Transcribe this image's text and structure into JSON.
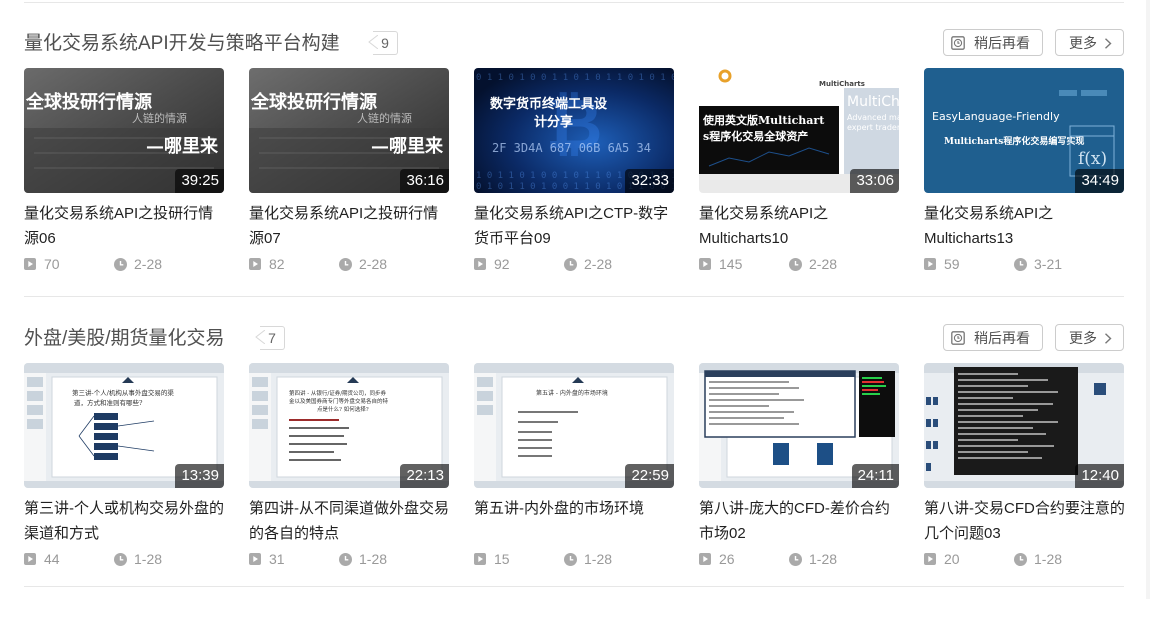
{
  "sections": [
    {
      "title": "量化交易系统API开发与策略平台构建",
      "count": "9",
      "watch_later_label": "稍后再看",
      "more_label": "更多",
      "videos": [
        {
          "title": "量化交易系统API之投研行情源06",
          "duration": "39:25",
          "plays": "70",
          "date": "2-28",
          "thumb_text": [
            "全球投研行情源",
            "人链的情源",
            "—哪里来"
          ]
        },
        {
          "title": "量化交易系统API之投研行情源07",
          "duration": "36:16",
          "plays": "82",
          "date": "2-28",
          "thumb_text": [
            "全球投研行情源",
            "人链的情源",
            "—哪里来"
          ]
        },
        {
          "title": "量化交易系统API之CTP-数字货币平台09",
          "duration": "32:33",
          "plays": "92",
          "date": "2-28",
          "thumb_text": [
            "数字货币终端工具设",
            "计分享",
            "2F 3D4A 687 06B 6A5 34"
          ]
        },
        {
          "title": "量化交易系统API之Multicharts10",
          "duration": "33:06",
          "plays": "145",
          "date": "2-28",
          "thumb_text": [
            "MultiCharts",
            "使用英文版Multichart",
            "s程序化交易全球资产",
            "MultiCha",
            "Advanced mark",
            "expert traders"
          ]
        },
        {
          "title": "量化交易系统API之Multicharts13",
          "duration": "34:49",
          "plays": "59",
          "date": "3-21",
          "thumb_text": [
            "EasyLanguage-Friendly",
            "Multicharts程序化交易编写实现",
            "f(x)"
          ]
        }
      ]
    },
    {
      "title": "外盘/美股/期货量化交易",
      "count": "7",
      "watch_later_label": "稍后再看",
      "more_label": "更多",
      "videos": [
        {
          "title": "第三讲-个人或机构交易外盘的渠道和方式",
          "duration": "13:39",
          "plays": "44",
          "date": "1-28",
          "thumb_text": [
            "第三讲-个人/机构从事外盘交易的渠",
            "道，方式和准则有哪些?"
          ]
        },
        {
          "title": "第四讲-从不同渠道做外盘交易的各自的特点",
          "duration": "22:13",
          "plays": "31",
          "date": "1-28",
          "thumb_text": [
            "第四讲 - 从银行/证券/期货公司，同步券",
            "金以及美国券商专门等外盘交易各自的特",
            "点是什么? 如何选择?"
          ]
        },
        {
          "title": "第五讲-内外盘的市场环境",
          "duration": "22:59",
          "plays": "15",
          "date": "1-28",
          "thumb_text": [
            "第五讲 - 内外盘的市场环境"
          ]
        },
        {
          "title": "第八讲-庞大的CFD-差价合约市场02",
          "duration": "24:11",
          "plays": "26",
          "date": "1-28",
          "thumb_text": []
        },
        {
          "title": "第八讲-交易CFD合约要注意的几个问题03",
          "duration": "12:40",
          "plays": "20",
          "date": "1-28",
          "thumb_text": []
        }
      ]
    }
  ]
}
